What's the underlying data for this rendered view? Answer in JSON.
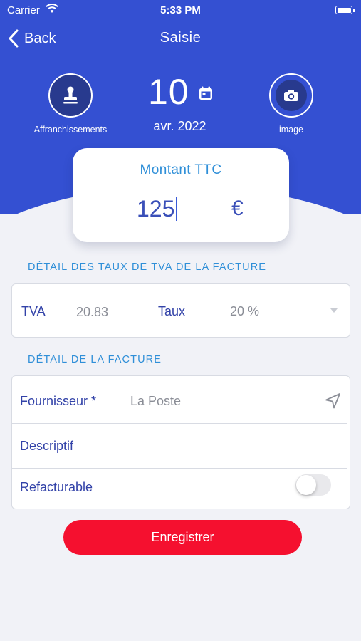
{
  "status_bar": {
    "carrier": "Carrier",
    "time": "5:33 PM"
  },
  "nav": {
    "back_label": "Back",
    "title": "Saisie"
  },
  "header": {
    "stamp_label": "Affranchissements",
    "date_day": "10",
    "date_month": "avr. 2022",
    "image_label": "image"
  },
  "amount": {
    "title": "Montant TTC",
    "value": "125",
    "currency": "€"
  },
  "tva_section": {
    "title": "DÉTAIL DES TAUX DE TVA DE LA FACTURE",
    "tva_label": "TVA",
    "tva_value": "20.83",
    "taux_label": "Taux",
    "taux_value": "20 %"
  },
  "detail_section": {
    "title": "DÉTAIL DE LA FACTURE",
    "supplier_label": "Fournisseur *",
    "supplier_value": "La Poste",
    "description_label": "Descriptif",
    "rebillable_label": "Refacturable",
    "rebillable_on": false
  },
  "save_label": "Enregistrer",
  "colors": {
    "primary": "#3450d2",
    "accent": "#2f8fd8",
    "danger": "#f5102f",
    "label": "#3242a8"
  }
}
